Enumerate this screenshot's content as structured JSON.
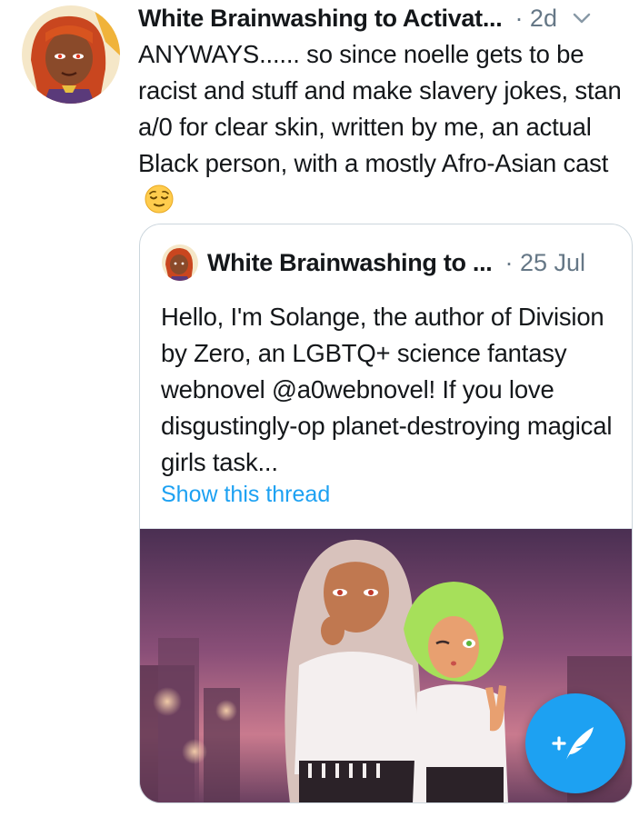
{
  "tweet": {
    "author": "White Brainwashing to Activat...",
    "time": "· 2d",
    "text": "ANYWAYS...... so since noelle gets to be racist and stuff and make slavery jokes, stan a/0 for clear skin, written by me, an actual Black person, with a mostly Afro-Asian cast",
    "emoji": "relieved-face"
  },
  "quote": {
    "author": "White Brainwashing to ...",
    "time": "· 25 Jul",
    "text": "Hello, I'm Solange, the author of Division by Zero, an LGBTQ+ science fantasy webnovel @a0webnovel! If you love disgustingly-op planet-destroying magical girls task...",
    "thread_link": "Show this thread"
  },
  "fab": {
    "icon": "compose-tweet-icon"
  },
  "colors": {
    "accent": "#1da1f2",
    "secondary_text": "#657786",
    "border": "#ccd6dd"
  }
}
